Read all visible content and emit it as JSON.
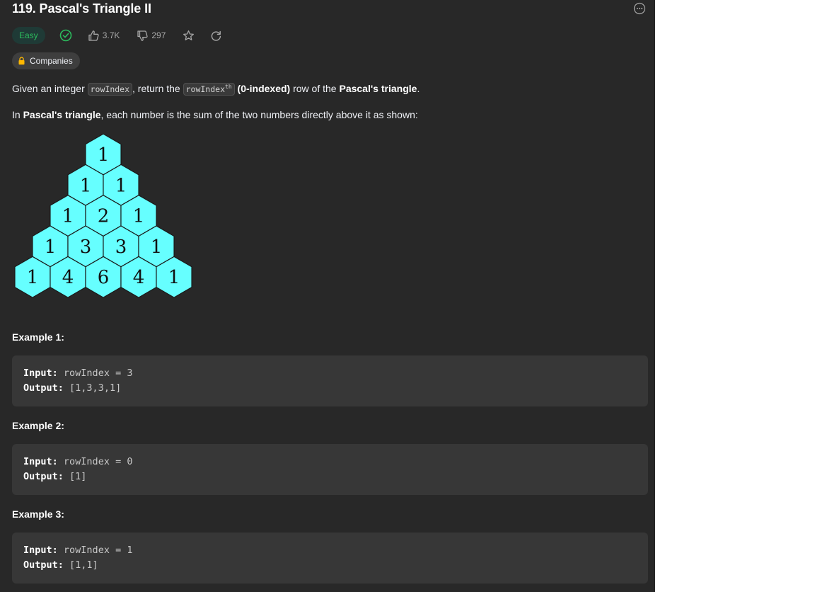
{
  "problem": {
    "title": "119. Pascal's Triangle II",
    "difficulty": "Easy",
    "likes": "3.7K",
    "dislikes": "297",
    "companies_label": "Companies"
  },
  "description": {
    "p1_a": "Given an integer ",
    "p1_code1": "rowIndex",
    "p1_b": ", return the ",
    "p1_code2": "rowIndex",
    "p1_sup": "th",
    "p1_c": " ",
    "p1_bold1": "(0-indexed)",
    "p1_d": " row of the ",
    "p1_bold2": "Pascal's triangle",
    "p1_e": ".",
    "p2_a": "In ",
    "p2_bold": "Pascal's triangle",
    "p2_b": ", each number is the sum of the two numbers directly above it as shown:"
  },
  "triangle": {
    "rows": [
      [
        1
      ],
      [
        1,
        1
      ],
      [
        1,
        2,
        1
      ],
      [
        1,
        3,
        3,
        1
      ],
      [
        1,
        4,
        6,
        4,
        1
      ]
    ],
    "fill": "#66ffff"
  },
  "examples": [
    {
      "label": "Example 1:",
      "input_label": "Input:",
      "input_value": "rowIndex = 3",
      "output_label": "Output:",
      "output_value": "[1,3,3,1]"
    },
    {
      "label": "Example 2:",
      "input_label": "Input:",
      "input_value": "rowIndex = 0",
      "output_label": "Output:",
      "output_value": "[1]"
    },
    {
      "label": "Example 3:",
      "input_label": "Input:",
      "input_value": "rowIndex = 1",
      "output_label": "Output:",
      "output_value": "[1,1]"
    }
  ],
  "colors": {
    "panel_bg": "#282828",
    "easy_text": "#2cbb5d",
    "easy_bg": "#1f3a36",
    "code_box_bg": "#373737"
  },
  "icons": {
    "solved": "check-circle-icon",
    "like": "thumbs-up-icon",
    "dislike": "thumbs-down-icon",
    "favorite": "star-icon",
    "reset": "refresh-icon",
    "more": "more-dots-icon",
    "lock": "lock-icon"
  }
}
